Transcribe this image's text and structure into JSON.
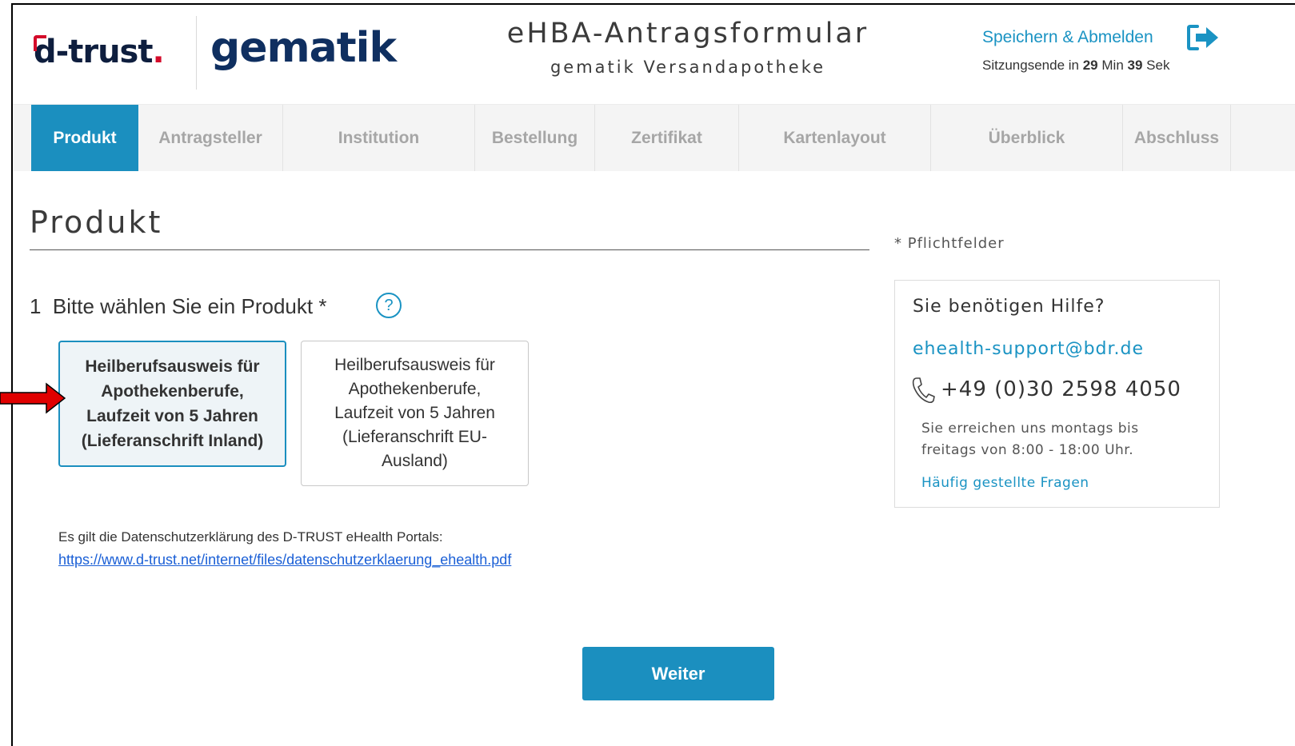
{
  "header": {
    "logo_dtrust": "d-trust",
    "logo_dtrust_dot": ".",
    "logo_gematik": "gematik",
    "title": "eHBA-Antragsformular",
    "subtitle": "gematik Versandapotheke",
    "save_logout_label": "Speichern & Abmelden",
    "session_prefix": "Sitzungsende in",
    "session_minutes": "29",
    "session_min_label": "Min",
    "session_seconds": "39",
    "session_sec_label": "Sek"
  },
  "tabs": [
    {
      "label": "Produkt",
      "active": true
    },
    {
      "label": "Antragsteller",
      "active": false
    },
    {
      "label": "Institution",
      "active": false
    },
    {
      "label": "Bestellung",
      "active": false
    },
    {
      "label": "Zertifikat",
      "active": false
    },
    {
      "label": "Kartenlayout",
      "active": false
    },
    {
      "label": "Überblick",
      "active": false
    },
    {
      "label": "Abschluss",
      "active": false
    }
  ],
  "main": {
    "heading": "Produkt",
    "required_note": "* Pflichtfelder",
    "question": "1  Bitte wählen Sie ein Produkt *",
    "help_symbol": "?",
    "options": [
      {
        "lines": [
          "Heilberufsausweis für",
          "Apothekenberufe,",
          "Laufzeit von 5 Jahren",
          "(Lieferanschrift Inland)"
        ],
        "selected": true
      },
      {
        "lines": [
          "Heilberufsausweis für",
          "Apothekenberufe,",
          "Laufzeit von 5 Jahren",
          "(Lieferanschrift EU-",
          "Ausland)"
        ],
        "selected": false
      }
    ],
    "privacy_text": "Es gilt die Datenschutzerklärung des D-TRUST eHealth Portals:",
    "privacy_link": "https://www.d-trust.net/internet/files/datenschutzerklaerung_ehealth.pdf",
    "next_button": "Weiter"
  },
  "help": {
    "title": "Sie benötigen Hilfe?",
    "email": "ehealth-support@bdr.de",
    "phone": "+49 (0)30 2598 4050",
    "hours_line1": "Sie erreichen uns montags bis",
    "hours_line2": "freitags von 8:00 - 18:00 Uhr.",
    "faq_link": "Häufig gestellte Fragen"
  },
  "annotation": {
    "arrow_color": "#e00000"
  },
  "colors": {
    "accent": "#1b8fbf",
    "link": "#1a93c3",
    "brand_red": "#d40b2a",
    "brand_navy": "#0f2f60"
  },
  "icons": {
    "logout": "logout-icon",
    "phone": "phone-icon",
    "help": "help-icon"
  }
}
